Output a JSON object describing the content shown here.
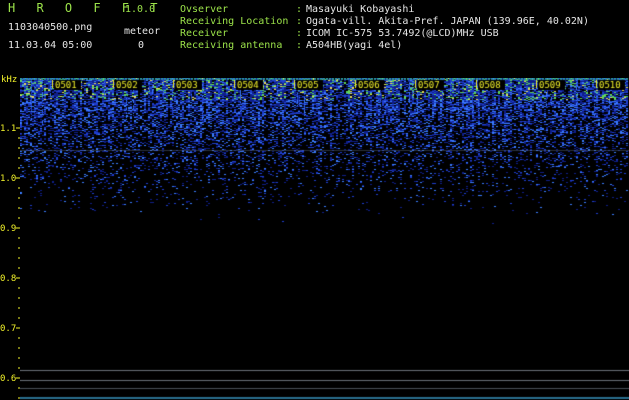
{
  "app": {
    "name": "H R O F F T",
    "version": "1.0.0"
  },
  "file": {
    "name": "1103040500.png",
    "datetime": "11.03.04 05:00"
  },
  "meteor": {
    "label": "meteor",
    "count": "0"
  },
  "meta": [
    {
      "key": "Ovserver",
      "sep": ":",
      "value": "Masayuki Kobayashi"
    },
    {
      "key": "Receiving Location",
      "sep": ":",
      "value": "Ogata-vill. Akita-Pref. JAPAN (139.96E, 40.02N)"
    },
    {
      "key": "Receiver",
      "sep": ":",
      "value": "ICOM IC-575 53.7492(@LCD)MHz USB"
    },
    {
      "key": "Receiving antenna",
      "sep": ":",
      "value": "A504HB(yagi 4el)"
    }
  ],
  "axis": {
    "unit": "kHz",
    "ticks": [
      "1.1",
      "1.0",
      "0.9",
      "0.8",
      "0.7",
      "0.6"
    ],
    "time_labels": [
      "0501",
      "0502",
      "0503",
      "0504",
      "0505",
      "0506",
      "0507",
      "0508",
      "0509",
      "0510"
    ]
  },
  "colors": {
    "accent_green": "#9ce34a",
    "tick_yellow": "#f2f22a",
    "noise_blue": "#1f3fd0",
    "hot_green": "#5fd85a"
  }
}
